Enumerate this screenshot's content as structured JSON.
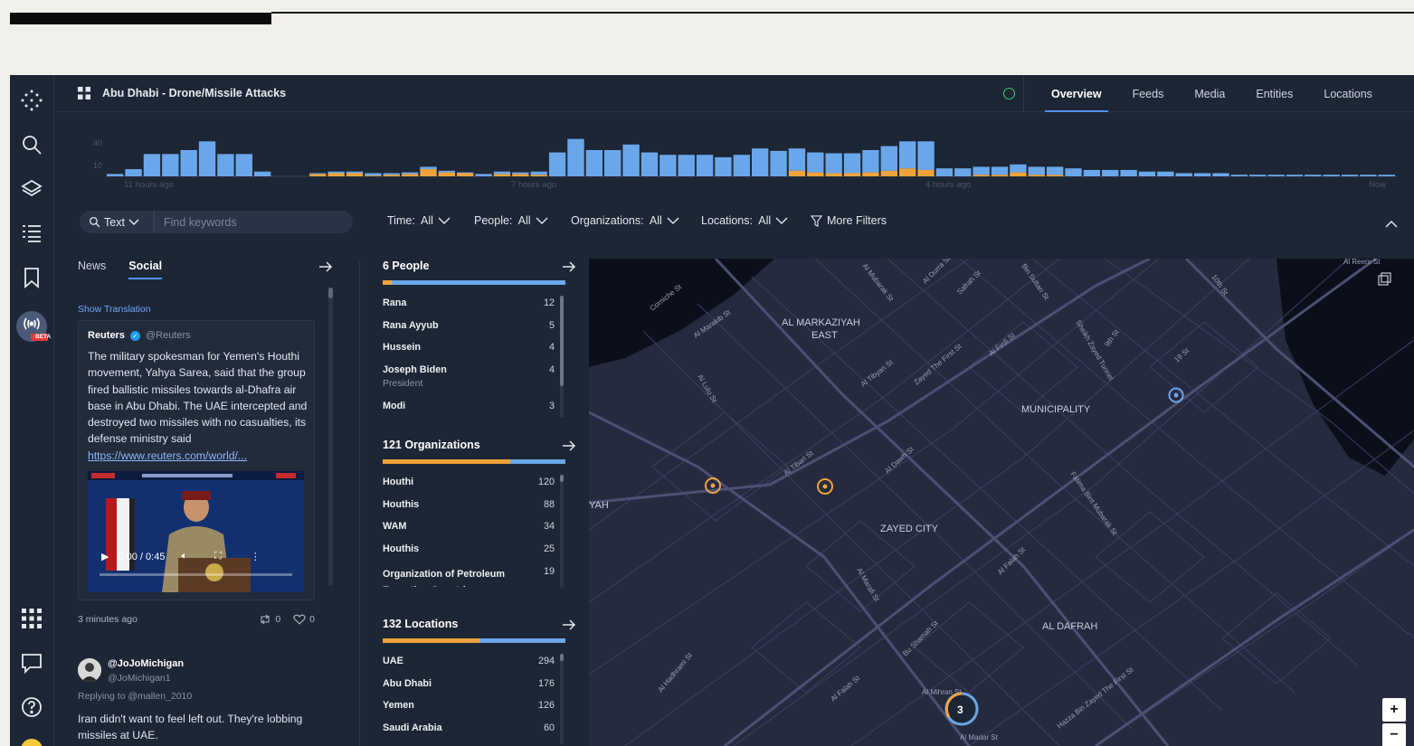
{
  "app": {
    "title": "Abu Dhabi - Drone/Missile Attacks",
    "tabs": [
      "Overview",
      "Feeds",
      "Media",
      "Entities",
      "Locations"
    ],
    "active_tab": "Overview",
    "beta_label": "BETA"
  },
  "timeline": {
    "y_ticks": [
      "40",
      "10"
    ],
    "x_labels": [
      "11 hours ago",
      "7 hours ago",
      "4 hours ago",
      "Now"
    ]
  },
  "chart_data": {
    "type": "bar",
    "categories": [
      "11 hours ago",
      "7 hours ago",
      "4 hours ago",
      "Now"
    ],
    "series": [
      {
        "values": [
          3,
          9,
          28,
          28,
          33,
          44,
          28,
          28,
          6,
          0,
          0,
          1,
          2,
          2,
          3,
          2,
          2,
          3,
          2,
          1,
          3,
          3,
          2,
          4,
          30,
          47,
          33,
          33,
          40,
          30,
          27,
          27,
          27,
          24,
          27,
          35,
          32,
          28,
          25,
          25,
          25,
          28,
          31,
          34,
          36,
          10,
          10,
          10,
          10,
          10,
          10,
          10,
          10,
          8,
          8,
          8,
          6,
          6,
          4,
          4,
          4,
          2,
          2,
          2,
          2,
          2,
          2,
          2,
          2,
          2
        ]
      },
      {
        "values": [
          0,
          0,
          0,
          0,
          0,
          0,
          0,
          0,
          0,
          0,
          0,
          3,
          4,
          4,
          1,
          2,
          3,
          9,
          5,
          4,
          0,
          3,
          3,
          2,
          0,
          0,
          0,
          0,
          0,
          0,
          0,
          0,
          0,
          0,
          0,
          0,
          0,
          7,
          5,
          4,
          4,
          5,
          7,
          10,
          8,
          0,
          0,
          2,
          2,
          5,
          2,
          2,
          0,
          0,
          0,
          0,
          0,
          0,
          0,
          0,
          0,
          0,
          0,
          0,
          0,
          0,
          0,
          0,
          0,
          0
        ]
      }
    ],
    "ylim": [
      0,
      50
    ]
  },
  "filters": {
    "search_mode": "Text",
    "search_placeholder": "Find keywords",
    "time": "Time:  All",
    "people": "People:  All",
    "organizations": "Organizations:  All",
    "locations": "Locations:  All",
    "more": "More Filters"
  },
  "feed": {
    "tabs": [
      "News",
      "Social"
    ],
    "show_translation": "Show Translation",
    "post": {
      "author": "Reuters",
      "handle": "@Reuters",
      "text": "The military spokesman for Yemen's Houthi movement, Yahya Sarea, said that the group fired ballistic missiles towards al-Dhafra air base in Abu Dhabi. The UAE intercepted and destroyed two missiles with no casualties, its defense ministry said",
      "link": "https://www.reuters.com/world/...",
      "video_time": "0:00 / 0:45",
      "age": "3 minutes ago",
      "retweets": "0",
      "likes": "0"
    },
    "reply": {
      "name": "@JoJoMichigan",
      "username": "@JoMichigan1",
      "replying_to": "Replying to @mallen_2010",
      "text": "Iran didn't want to feel left out. They're lobbing missiles at UAE."
    }
  },
  "entities": {
    "people": {
      "title": "6 People",
      "rows": [
        {
          "name": "Rana",
          "count": "12"
        },
        {
          "name": "Rana Ayyub",
          "count": "5"
        },
        {
          "name": "Hussein",
          "count": "4"
        },
        {
          "name": "Joseph Biden",
          "count": "4",
          "sub": "President"
        },
        {
          "name": "Modi",
          "count": "3"
        }
      ]
    },
    "organizations": {
      "title": "121 Organizations",
      "rows": [
        {
          "name": "Houthi",
          "count": "120"
        },
        {
          "name": "Houthis",
          "count": "88"
        },
        {
          "name": "WAM",
          "count": "34"
        },
        {
          "name": "Houthis",
          "count": "25"
        },
        {
          "name": "Organization of Petroleum Exporting Countries",
          "count": "19"
        }
      ]
    },
    "locations": {
      "title": "132 Locations",
      "rows": [
        {
          "name": "UAE",
          "count": "294"
        },
        {
          "name": "Abu Dhabi",
          "count": "176"
        },
        {
          "name": "Yemen",
          "count": "126"
        },
        {
          "name": "Saudi Arabia",
          "count": "60"
        }
      ]
    }
  },
  "map": {
    "districts": [
      "AL MARKAZIYAH",
      "EAST",
      "MUNICIPALITY",
      "ZAYED CITY",
      "AL DAFRAH",
      "YAH"
    ],
    "streets": [
      "Corniche St",
      "Al Falah St",
      "Al Marakib St",
      "Zayed The First St",
      "Al Firdi St",
      "Sheikh Zayed Tunnel",
      "Al Tibyan St",
      "Al Mubarak St",
      "Al Durra St",
      "Safrah St",
      "Bin Sultan St",
      "19 St",
      "10th St",
      "9th St",
      "Al Lulu St",
      "Al Tibari St",
      "Al Dawh St",
      "Hazza Bin Zayed The First St",
      "Al Madar St",
      "Al Mihran St",
      "Fatima Bint Mubarak St",
      "Al Hadhrami St",
      "Al Reem St",
      "Al Falah St",
      "Al Marafi St",
      "Bu Shamah St"
    ],
    "cluster_count": "3",
    "zoom_in": "+",
    "zoom_out": "−"
  },
  "colors": {
    "accent_blue": "#6aa7ea",
    "accent_orange": "#f0a33c",
    "app_bg": "#1d2634",
    "map_bg": "#262a3e"
  }
}
